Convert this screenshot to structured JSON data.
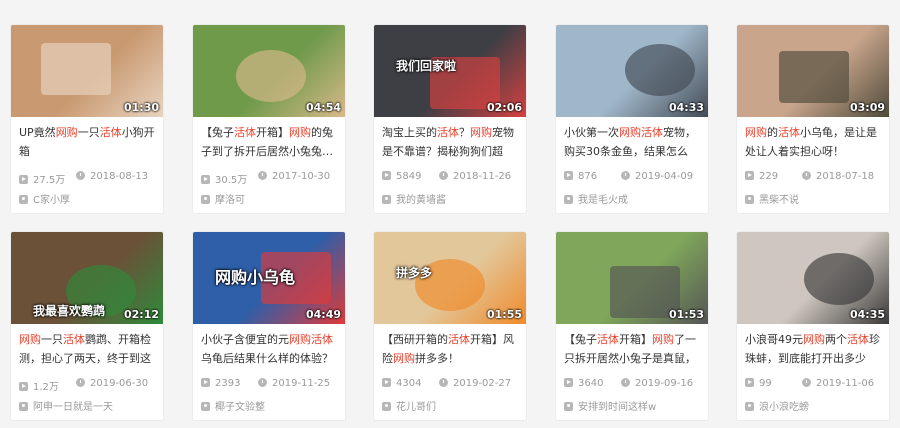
{
  "cards": [
    {
      "duration": "01:30",
      "title_parts": [
        {
          "t": "UP竟然",
          "hl": false
        },
        {
          "t": "网购",
          "hl": true
        },
        {
          "t": "一只",
          "hl": false
        },
        {
          "t": "活体",
          "hl": true
        },
        {
          "t": "小狗开箱",
          "hl": false
        }
      ],
      "views": "27.5万",
      "date": "2018-08-13",
      "author": "C家小厚",
      "thumb": {
        "bg": "#c99a72",
        "accent": "#e8d4c0",
        "overlay": ""
      }
    },
    {
      "duration": "04:54",
      "title_parts": [
        {
          "t": "【兔子",
          "hl": false
        },
        {
          "t": "活体",
          "hl": true
        },
        {
          "t": "开箱】",
          "hl": false
        },
        {
          "t": "网购",
          "hl": true
        },
        {
          "t": "的兔子到了拆开后居然小兔兔是真的",
          "hl": false
        }
      ],
      "views": "30.5万",
      "date": "2017-10-30",
      "author": "摩洛可",
      "thumb": {
        "bg": "#6f9a4a",
        "accent": "#d8b98a",
        "overlay": ""
      }
    },
    {
      "duration": "02:06",
      "title_parts": [
        {
          "t": "淘宝上买的",
          "hl": false
        },
        {
          "t": "活体",
          "hl": true
        },
        {
          "t": "？",
          "hl": false
        },
        {
          "t": "网购",
          "hl": true
        },
        {
          "t": "宠物是不靠谱？揭秘狗狗们超",
          "hl": false
        }
      ],
      "views": "5849",
      "date": "2018-11-26",
      "author": "我的黄墙酱",
      "thumb": {
        "bg": "#3d3f45",
        "accent": "#d84040",
        "overlay": "我们回家啦"
      }
    },
    {
      "duration": "04:33",
      "title_parts": [
        {
          "t": "小伙第一次",
          "hl": false
        },
        {
          "t": "网购活体",
          "hl": true
        },
        {
          "t": "宠物，购买30条金鱼，结果怎么",
          "hl": false
        }
      ],
      "views": "876",
      "date": "2019-04-09",
      "author": "我是毛火成",
      "thumb": {
        "bg": "#9fb7c9",
        "accent": "#444a55",
        "overlay": ""
      }
    },
    {
      "duration": "03:09",
      "title_parts": [
        {
          "t": "网购",
          "hl": true
        },
        {
          "t": "的",
          "hl": false
        },
        {
          "t": "活体",
          "hl": true
        },
        {
          "t": "小乌龟，是让是处让人着实担心呀！",
          "hl": false
        }
      ],
      "views": "229",
      "date": "2018-07-18",
      "author": "黑柴不说",
      "thumb": {
        "bg": "#c9a58c",
        "accent": "#4e4a3a",
        "overlay": ""
      }
    },
    {
      "duration": "02:12",
      "title_parts": [
        {
          "t": "网购",
          "hl": true
        },
        {
          "t": "一只",
          "hl": false
        },
        {
          "t": "活体",
          "hl": true
        },
        {
          "t": "鹦鹉、开箱检测，担心了两天，终于到这",
          "hl": false
        }
      ],
      "views": "1.2万",
      "date": "2019-06-30",
      "author": "阿申一日就是一天",
      "thumb": {
        "bg": "#6b5138",
        "accent": "#2f8a3b",
        "overlay": "我最喜欢鹦鹉"
      }
    },
    {
      "duration": "04:49",
      "title_parts": [
        {
          "t": "小伙子含便宜的元",
          "hl": false
        },
        {
          "t": "网购活体",
          "hl": true
        },
        {
          "t": "乌龟后结果什么样的体验？",
          "hl": false
        }
      ],
      "views": "2393",
      "date": "2019-11-25",
      "author": "椰子文验整",
      "thumb": {
        "bg": "#2f5fa8",
        "accent": "#e03a3a",
        "overlay": "网购小乌龟"
      }
    },
    {
      "duration": "01:55",
      "title_parts": [
        {
          "t": "【西研开箱的",
          "hl": false
        },
        {
          "t": "活体",
          "hl": true
        },
        {
          "t": "开箱】风险",
          "hl": false
        },
        {
          "t": "网购",
          "hl": true
        },
        {
          "t": "拼多多！",
          "hl": false
        }
      ],
      "views": "4304",
      "date": "2019-02-27",
      "author": "花儿哥们",
      "thumb": {
        "bg": "#e2c79a",
        "accent": "#f08a2a",
        "overlay": "拼多多"
      }
    },
    {
      "duration": "01:53",
      "title_parts": [
        {
          "t": "【兔子",
          "hl": false
        },
        {
          "t": "活体",
          "hl": true
        },
        {
          "t": "开箱】",
          "hl": false
        },
        {
          "t": "网购",
          "hl": true
        },
        {
          "t": "了一只拆开居然小兔子是真鼠，",
          "hl": false
        }
      ],
      "views": "3640",
      "date": "2019-09-16",
      "author": "安排到时间这样w",
      "thumb": {
        "bg": "#7fa65a",
        "accent": "#555555",
        "overlay": ""
      }
    },
    {
      "duration": "04:35",
      "title_parts": [
        {
          "t": "小浪哥49元",
          "hl": false
        },
        {
          "t": "网购",
          "hl": true
        },
        {
          "t": "两个",
          "hl": false
        },
        {
          "t": "活体",
          "hl": true
        },
        {
          "t": "珍珠蚌，到底能打开出多少",
          "hl": false
        }
      ],
      "views": "99",
      "date": "2019-11-06",
      "author": "浪小浪吃螃",
      "thumb": {
        "bg": "#cfc7bf",
        "accent": "#3a3a3a",
        "overlay": ""
      }
    }
  ],
  "icons": {
    "views": "play-count-icon",
    "date": "clock-icon",
    "author": "uploader-icon"
  },
  "colors": {
    "highlight": "#e8412c",
    "meta": "#9a9a9a"
  }
}
